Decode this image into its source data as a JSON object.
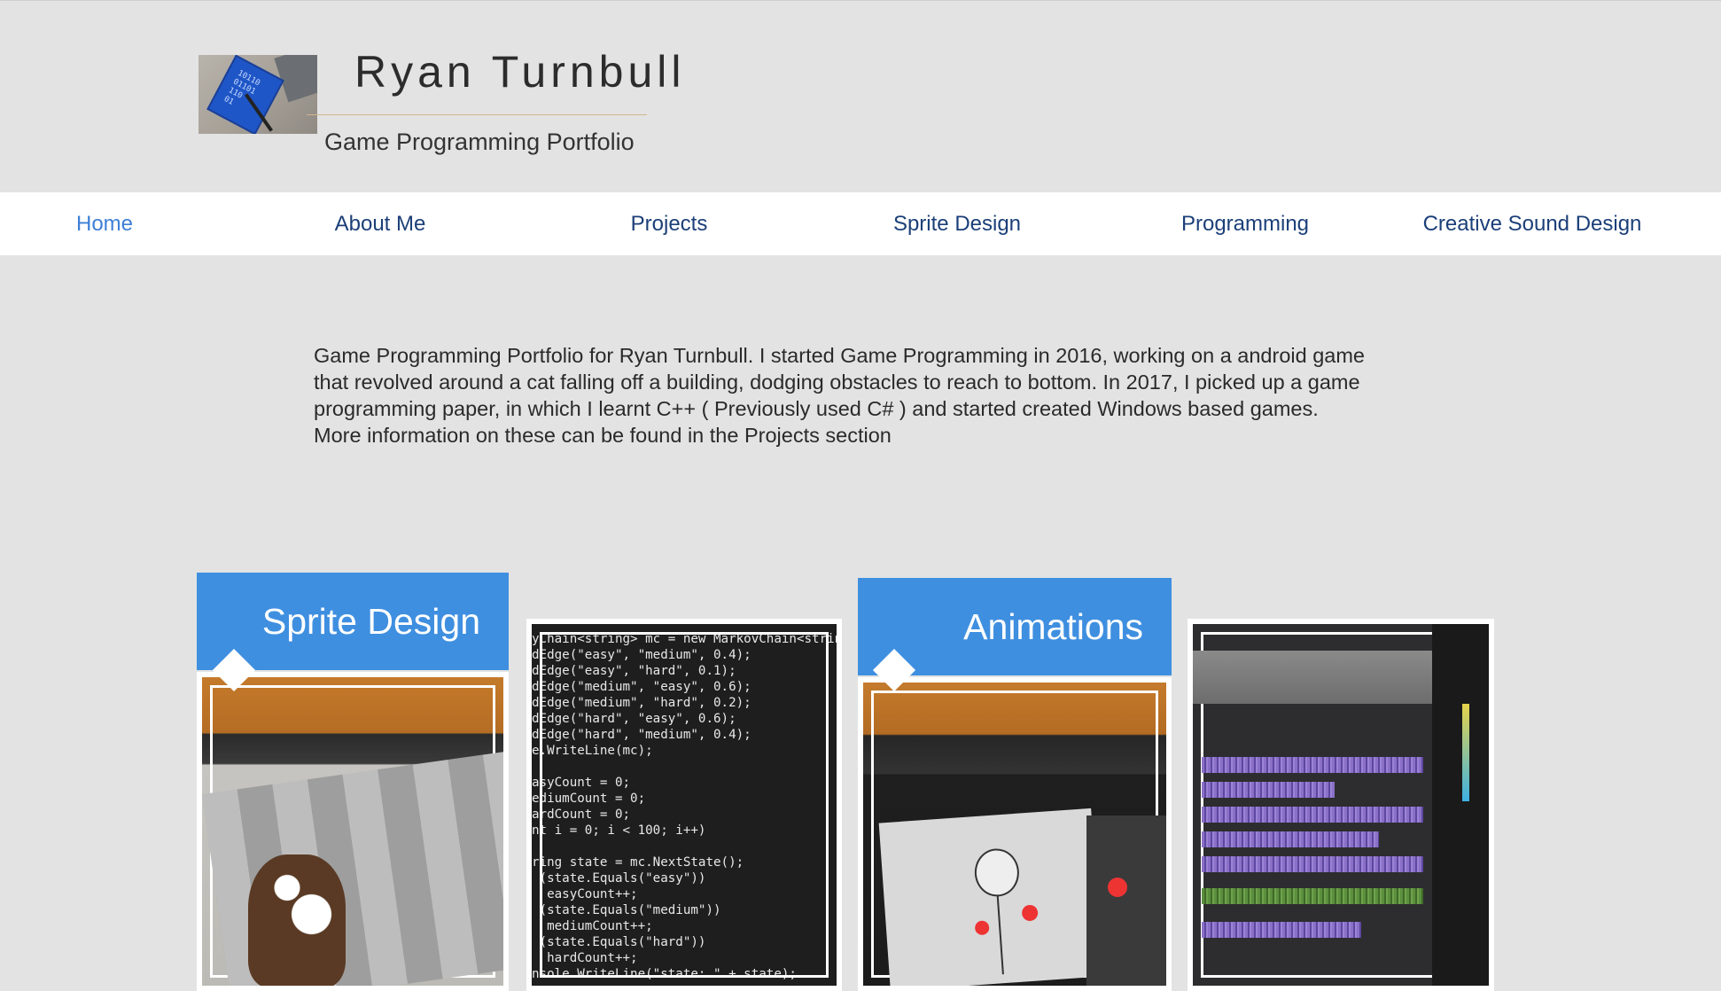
{
  "header": {
    "title": "Ryan Turnbull",
    "subtitle": "Game Programming Portfolio"
  },
  "nav": {
    "items": [
      {
        "label": "Home",
        "active": true
      },
      {
        "label": "About Me"
      },
      {
        "label": "Projects"
      },
      {
        "label": "Sprite Design"
      },
      {
        "label": "Programming"
      },
      {
        "label": "Creative Sound Design"
      }
    ]
  },
  "intro": {
    "text": "Game Programming Portfolio for Ryan Turnbull. I started Game Programming in 2016, working on a android game that revolved around a cat falling off a building, dodging obstacles to reach to bottom. In 2017, I picked up a game programming paper, in which I learnt C++ ( Previously used C# ) and started created Windows based games. More information on these can be found in the Projects section"
  },
  "gallery": {
    "cards": [
      {
        "title": "Sprite Design"
      },
      {
        "title": "Animations"
      }
    ],
    "code_lines": [
      "yChain<string> mc = new MarkovChain<string>(",
      "dEdge(\"easy\", \"medium\", 0.4);",
      "dEdge(\"easy\", \"hard\", 0.1);",
      "dEdge(\"medium\", \"easy\", 0.6);",
      "dEdge(\"medium\", \"hard\", 0.2);",
      "dEdge(\"hard\", \"easy\", 0.6);",
      "dEdge(\"hard\", \"medium\", 0.4);",
      "e.WriteLine(mc);",
      "",
      "asyCount = 0;",
      "ediumCount = 0;",
      "ardCount = 0;",
      "nt i = 0; i < 100; i++)",
      "",
      "ring state = mc.NextState();",
      " (state.Equals(\"easy\"))",
      "  easyCount++;",
      " (state.Equals(\"medium\"))",
      "  mediumCount++;",
      " (state.Equals(\"hard\"))",
      "  hardCount++;",
      "nsole.WriteLine(\"state: \" + state);"
    ]
  },
  "colors": {
    "accent": "#3f8fe0",
    "nav_text": "#1b3f78",
    "nav_active": "#3d7fd6",
    "background": "#e3e3e3"
  }
}
